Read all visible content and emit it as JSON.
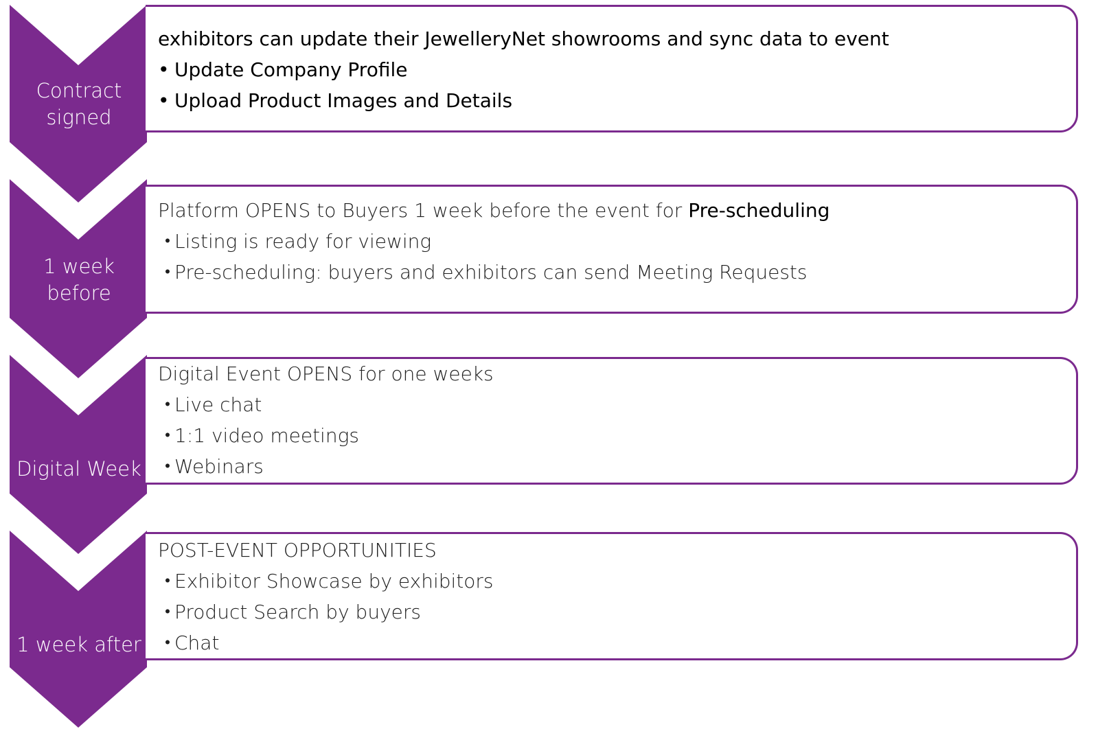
{
  "colors": {
    "accent": "#7b2a8e",
    "box_border": "#7b2a8e",
    "text": "#1e1e1e"
  },
  "steps": [
    {
      "stage": "Contract signed",
      "stage_lines": [
        "Contract",
        "signed"
      ],
      "title": "exhibitors can update their JewelleryNet showrooms and sync data to event",
      "title_highlight": "",
      "items": [
        "Update Company Profile",
        "Upload Product Images and Details"
      ],
      "bullet": "•"
    },
    {
      "stage": "1 week before",
      "stage_lines": [
        "1 week",
        "before"
      ],
      "title": "Platform OPENS to Buyers 1 week before the event for ",
      "title_highlight": "Pre-scheduling",
      "items": [
        "Listing is ready for viewing",
        "Pre-scheduling: buyers and exhibitors can send Meeting Requests"
      ],
      "bullet": "・"
    },
    {
      "stage": "Digital Week",
      "stage_lines": [
        "Digital Week"
      ],
      "title": "Digital Event OPENS for one weeks",
      "title_highlight": "",
      "items": [
        "Live chat",
        "1:1 video meetings",
        "Webinars"
      ],
      "bullet": "・"
    },
    {
      "stage": "1 week after",
      "stage_lines": [
        "1 week after"
      ],
      "title": "POST-EVENT  OPPORTUNITIES",
      "title_highlight": "",
      "items": [
        "Exhibitor Showcase by exhibitors",
        "Product Search by buyers",
        "Chat"
      ],
      "bullet": "・"
    }
  ]
}
